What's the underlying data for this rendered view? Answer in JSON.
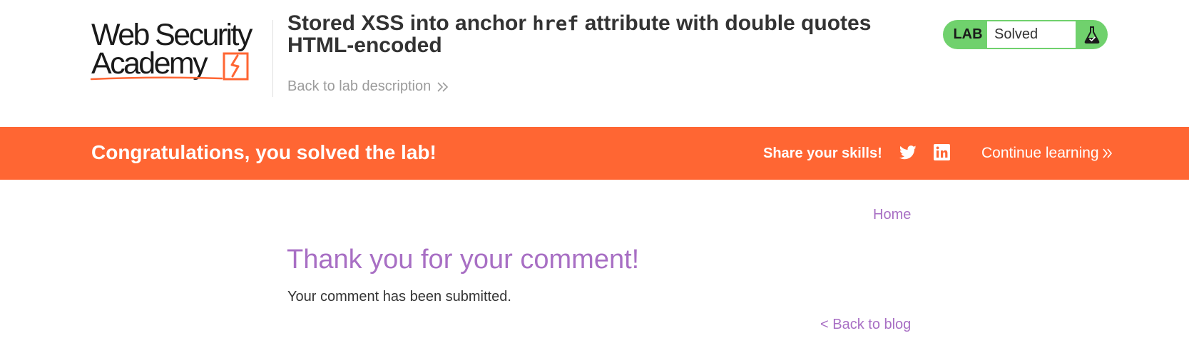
{
  "header": {
    "logo": {
      "line1": "Web Security",
      "line2": "Academy"
    },
    "title_parts": {
      "before": "Stored XSS into anchor ",
      "code": "href",
      "after": " attribute with double quotes HTML-encoded"
    },
    "back_link": "Back to lab description",
    "lab_status": {
      "label": "LAB",
      "state": "Solved",
      "icon": "flask-icon"
    }
  },
  "banner": {
    "message": "Congratulations, you solved the lab!",
    "share_label": "Share your skills!",
    "share_icons": [
      "twitter-icon",
      "linkedin-icon"
    ],
    "continue_label": "Continue learning"
  },
  "main": {
    "nav_home": "Home",
    "title": "Thank you for your comment!",
    "message": "Your comment has been submitted.",
    "back_link": "< Back to blog"
  },
  "colors": {
    "accent_orange": "#ff6633",
    "solved_green": "#70d16d",
    "link_purple": "#a86fc4",
    "text": "#333333",
    "muted": "#9b9b9b"
  }
}
